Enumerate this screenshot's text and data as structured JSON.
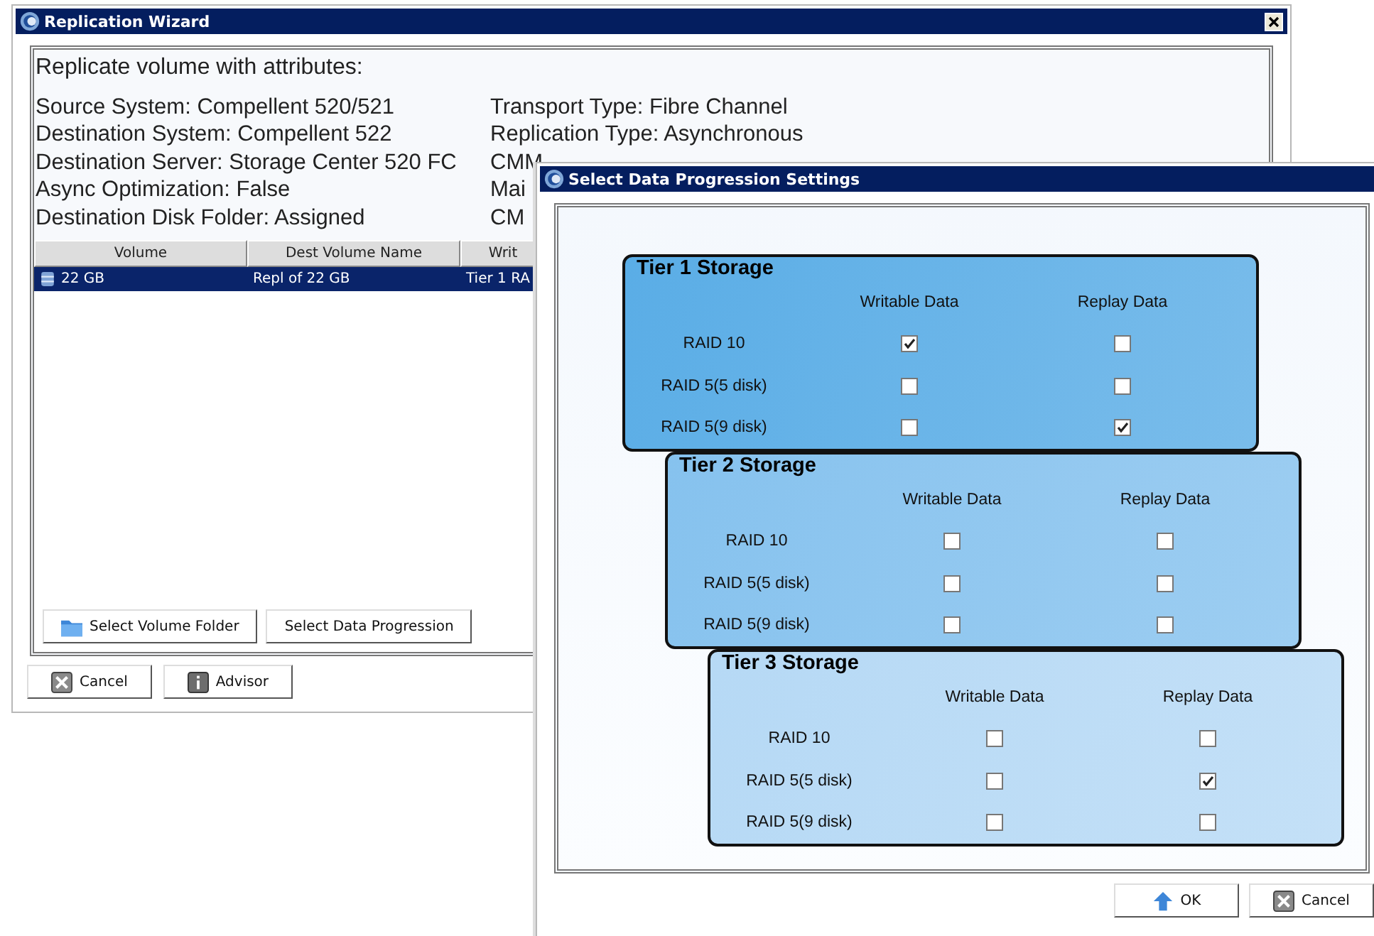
{
  "wizard": {
    "title": "Replication Wizard",
    "heading": "Replicate volume with attributes:",
    "left_info": [
      "Source System: Compellent 520/521",
      "Destination System: Compellent 522",
      "Destination Server: Storage Center 520 FC",
      "Async Optimization: False",
      "Destination Disk Folder: Assigned"
    ],
    "right_info": [
      "Transport Type: Fibre Channel",
      "Replication Type: Asynchronous",
      "CMM",
      "Mai",
      "CM"
    ],
    "table": {
      "columns": [
        "Volume",
        "Dest Volume Name",
        "Writ"
      ],
      "rows": [
        {
          "cells": [
            "22 GB",
            "Repl of 22 GB",
            "Tier 1 RA"
          ],
          "selected": true
        }
      ]
    },
    "panel_buttons": [
      "Select Volume Folder",
      "Select Data Progression"
    ],
    "buttons": [
      "Cancel",
      "Advisor"
    ]
  },
  "dialog": {
    "title": "Select Data Progression Settings",
    "tiers": [
      {
        "title": "Tier 1 Storage",
        "color": "#5aade6",
        "columns": [
          "Writable Data",
          "Replay Data"
        ],
        "rows": [
          {
            "label": "RAID 10",
            "writable": true,
            "replay": false
          },
          {
            "label": "RAID 5(5 disk)",
            "writable": false,
            "replay": false
          },
          {
            "label": "RAID 5(9 disk)",
            "writable": false,
            "replay": true
          }
        ]
      },
      {
        "title": "Tier 2 Storage",
        "color": "#86c2ee",
        "columns": [
          "Writable Data",
          "Replay Data"
        ],
        "rows": [
          {
            "label": "RAID 10",
            "writable": false,
            "replay": false
          },
          {
            "label": "RAID 5(5 disk)",
            "writable": false,
            "replay": false
          },
          {
            "label": "RAID 5(9 disk)",
            "writable": false,
            "replay": false
          }
        ]
      },
      {
        "title": "Tier 3 Storage",
        "color": "#b6d9f5",
        "columns": [
          "Writable Data",
          "Replay Data"
        ],
        "rows": [
          {
            "label": "RAID 10",
            "writable": false,
            "replay": false
          },
          {
            "label": "RAID 5(5 disk)",
            "writable": false,
            "replay": true
          },
          {
            "label": "RAID 5(9 disk)",
            "writable": false,
            "replay": false
          }
        ]
      }
    ],
    "buttons": [
      "OK",
      "Cancel"
    ]
  }
}
